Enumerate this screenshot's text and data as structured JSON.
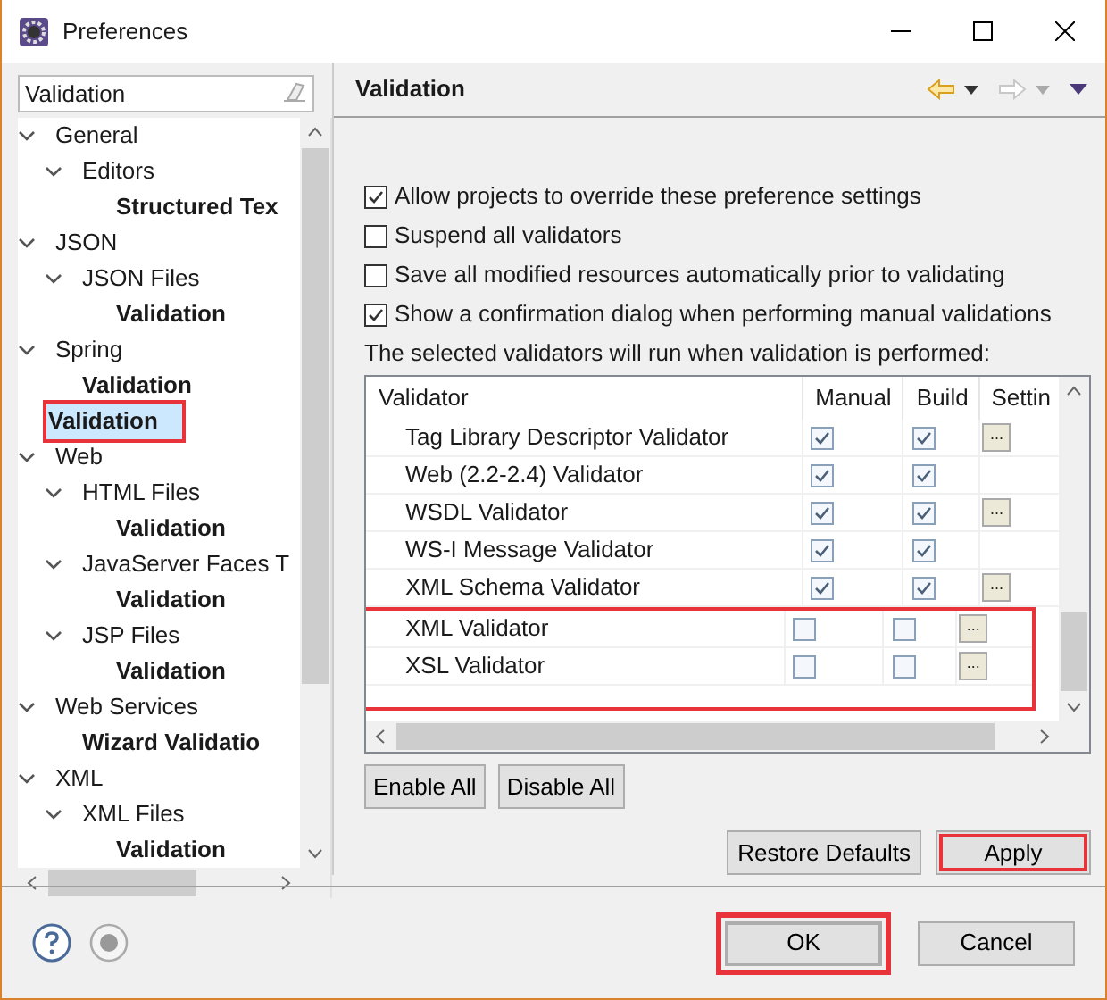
{
  "window": {
    "title": "Preferences"
  },
  "filter": {
    "value": "Validation"
  },
  "tree": [
    {
      "label": "General",
      "expanded": true,
      "matched": false,
      "selected": false,
      "highlighted": false,
      "children": [
        {
          "label": "Editors",
          "expanded": true,
          "matched": false,
          "selected": false,
          "highlighted": false,
          "children": [
            {
              "label": "Structured Tex",
              "matched": true,
              "selected": false,
              "highlighted": false
            }
          ]
        }
      ]
    },
    {
      "label": "JSON",
      "expanded": true,
      "matched": false,
      "selected": false,
      "highlighted": false,
      "children": [
        {
          "label": "JSON Files",
          "expanded": true,
          "matched": false,
          "selected": false,
          "highlighted": false,
          "children": [
            {
              "label": "Validation",
              "matched": true,
              "selected": false,
              "highlighted": false
            }
          ]
        }
      ]
    },
    {
      "label": "Spring",
      "expanded": true,
      "matched": false,
      "selected": false,
      "highlighted": false,
      "children": [
        {
          "label": "Validation",
          "matched": true,
          "selected": false,
          "highlighted": false
        }
      ]
    },
    {
      "label": "Validation",
      "matched": true,
      "selected": true,
      "highlighted": true
    },
    {
      "label": "Web",
      "expanded": true,
      "matched": false,
      "selected": false,
      "highlighted": false,
      "children": [
        {
          "label": "HTML Files",
          "expanded": true,
          "matched": false,
          "selected": false,
          "highlighted": false,
          "children": [
            {
              "label": "Validation",
              "matched": true,
              "selected": false,
              "highlighted": false
            }
          ]
        },
        {
          "label": "JavaServer Faces T",
          "expanded": true,
          "matched": false,
          "selected": false,
          "highlighted": false,
          "children": [
            {
              "label": "Validation",
              "matched": true,
              "selected": false,
              "highlighted": false
            }
          ]
        },
        {
          "label": "JSP Files",
          "expanded": true,
          "matched": false,
          "selected": false,
          "highlighted": false,
          "children": [
            {
              "label": "Validation",
              "matched": true,
              "selected": false,
              "highlighted": false
            }
          ]
        }
      ]
    },
    {
      "label": "Web Services",
      "expanded": true,
      "matched": false,
      "selected": false,
      "highlighted": false,
      "children": [
        {
          "label": "Wizard Validatio",
          "matched": true,
          "selected": false,
          "highlighted": false
        }
      ]
    },
    {
      "label": "XML",
      "expanded": true,
      "matched": false,
      "selected": false,
      "highlighted": false,
      "children": [
        {
          "label": "XML Files",
          "expanded": true,
          "matched": false,
          "selected": false,
          "highlighted": false,
          "children": [
            {
              "label": "Validation",
              "matched": true,
              "selected": false,
              "highlighted": false
            }
          ]
        }
      ]
    }
  ],
  "page": {
    "title": "Validation"
  },
  "options": [
    {
      "label": "Allow projects to override these preference settings",
      "checked": true
    },
    {
      "label": "Suspend all validators",
      "checked": false
    },
    {
      "label": "Save all modified resources automatically prior to validating",
      "checked": false
    },
    {
      "label": "Show a confirmation dialog when performing manual validations",
      "checked": true
    }
  ],
  "table_caption": "The selected validators will run when validation is performed:",
  "table": {
    "columns": [
      "Validator",
      "Manual",
      "Build",
      "Settin"
    ],
    "rows": [
      {
        "name": "Tag Library Descriptor Validator",
        "manual": true,
        "build": true,
        "settings": "...",
        "highlighted": false
      },
      {
        "name": "Web (2.2-2.4) Validator",
        "manual": true,
        "build": true,
        "highlighted": false
      },
      {
        "name": "WSDL Validator",
        "manual": true,
        "build": true,
        "settings": "...",
        "highlighted": false
      },
      {
        "name": "WS-I Message Validator",
        "manual": true,
        "build": true,
        "highlighted": false
      },
      {
        "name": "XML Schema Validator",
        "manual": true,
        "build": true,
        "settings": "...",
        "highlighted": false
      },
      {
        "name": "XML Validator",
        "manual": false,
        "build": false,
        "settings": "...",
        "highlighted": true
      },
      {
        "name": "XSL Validator",
        "manual": false,
        "build": false,
        "settings": "...",
        "highlighted": true
      }
    ]
  },
  "table_buttons": [
    {
      "label": "Enable All"
    },
    {
      "label": "Disable All"
    }
  ],
  "page_buttons": [
    {
      "label": "Restore Defaults",
      "highlighted": false
    },
    {
      "label": "Apply",
      "highlighted": true
    }
  ],
  "dialog_buttons": [
    {
      "label": "OK",
      "default": true,
      "highlighted": true
    },
    {
      "label": "Cancel",
      "default": false,
      "highlighted": false
    }
  ]
}
